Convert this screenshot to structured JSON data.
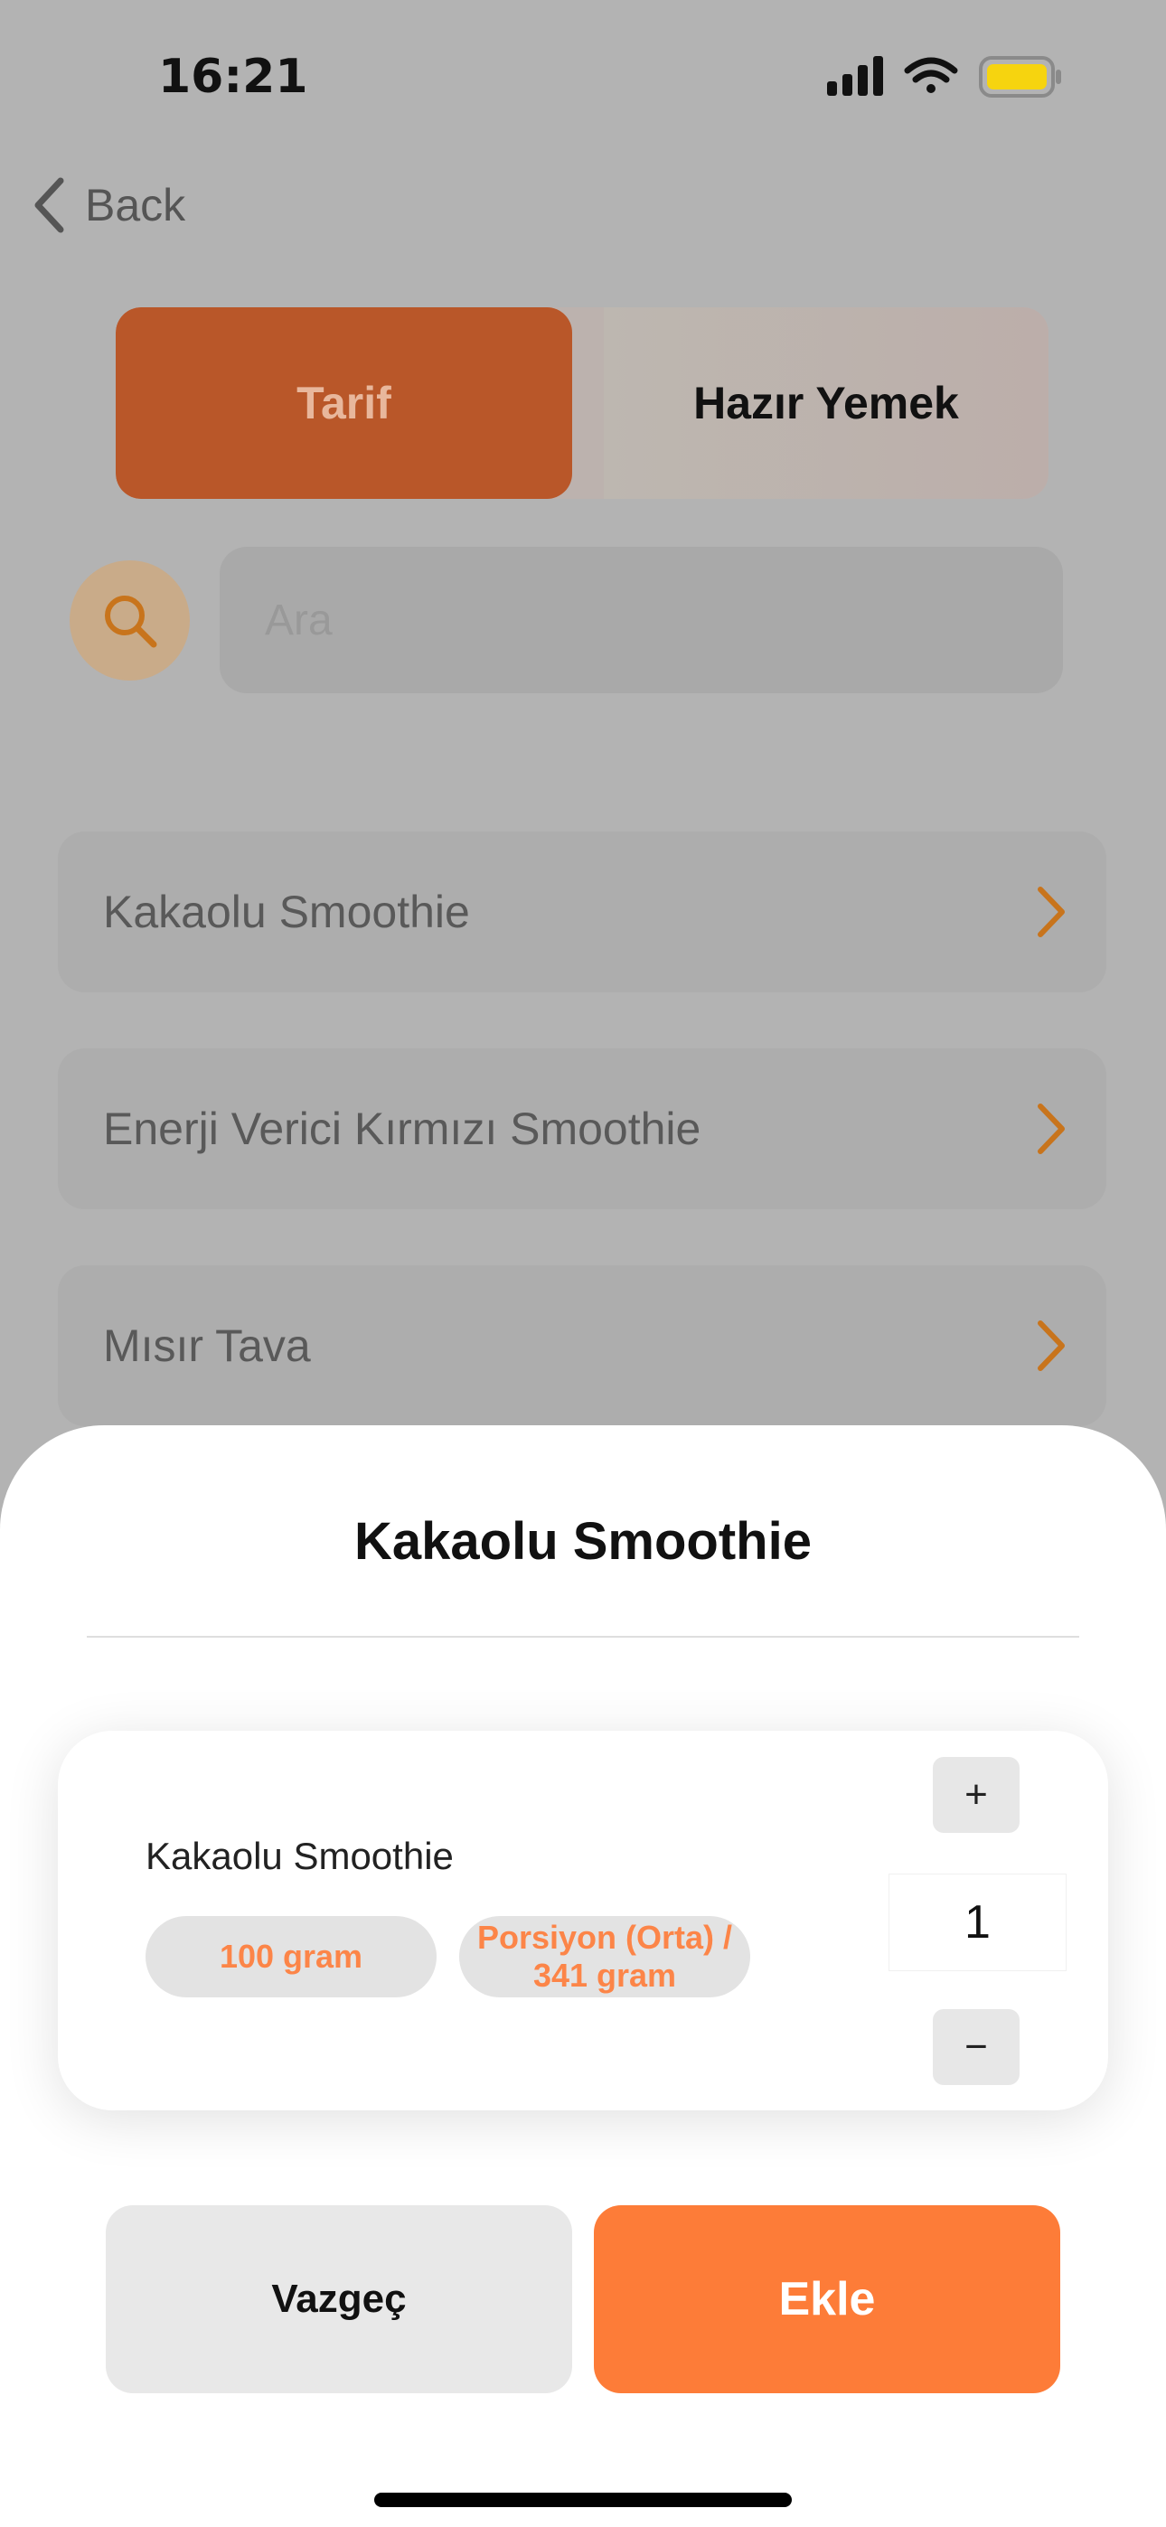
{
  "status_bar": {
    "time": "16:21"
  },
  "nav": {
    "back_label": "Back"
  },
  "segment": {
    "tabs": [
      "Tarif",
      "Hazır Yemek"
    ],
    "active": "Tarif"
  },
  "search": {
    "placeholder": "Ara"
  },
  "list": {
    "items": [
      "Kakaolu Smoothie",
      "Enerji Verici Kırmızı Smoothie",
      "Mısır Tava"
    ]
  },
  "sheet": {
    "title": "Kakaolu Smoothie",
    "item": {
      "name": "Kakaolu Smoothie",
      "portion_options": [
        "100 gram",
        "Porsiyon (Orta) / 341 gram"
      ],
      "quantity": "1",
      "plus_label": "+",
      "minus_label": "−"
    },
    "cancel_label": "Vazgeç",
    "add_label": "Ekle"
  },
  "colors": {
    "accent": "#fd7c38",
    "active_tab": "#b95729",
    "chevron": "#c8741c",
    "overlay_bg": "#b3b3b3"
  },
  "icons": [
    "signal-icon",
    "wifi-icon",
    "battery-icon",
    "back-chevron-icon",
    "search-icon",
    "chevron-right-icon"
  ]
}
